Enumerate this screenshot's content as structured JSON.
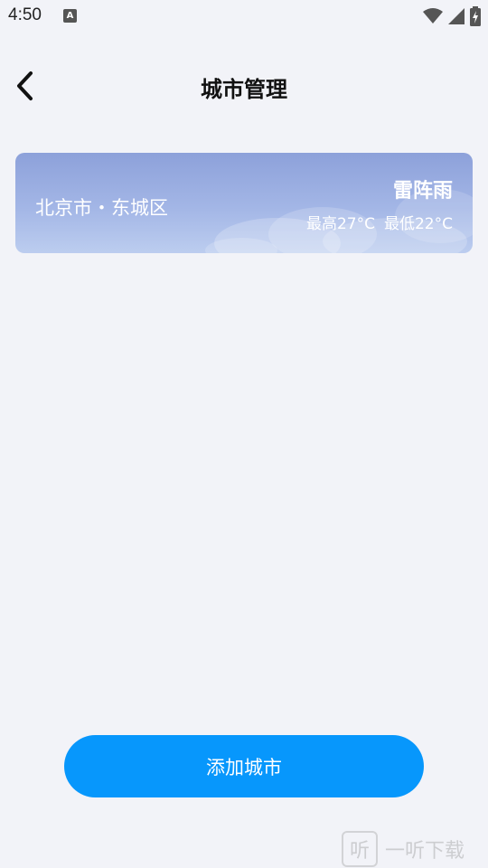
{
  "status": {
    "time": "4:50",
    "notif_glyph": "A",
    "icons": [
      "wifi-icon",
      "signal-icon",
      "battery-charging-icon"
    ]
  },
  "header": {
    "title": "城市管理",
    "back_icon": "chevron-left-icon"
  },
  "cities": [
    {
      "name": "北京市・东城区",
      "condition": "雷阵雨",
      "high": "最高27°C",
      "low": "最低22°C"
    }
  ],
  "actions": {
    "add_city_label": "添加城市"
  },
  "watermark": {
    "logo_glyph": "听",
    "text": "一听下载"
  },
  "colors": {
    "background": "#f2f3f8",
    "accent": "#0797fc",
    "card_top": "#8da1da",
    "card_bottom": "#bccdef"
  }
}
